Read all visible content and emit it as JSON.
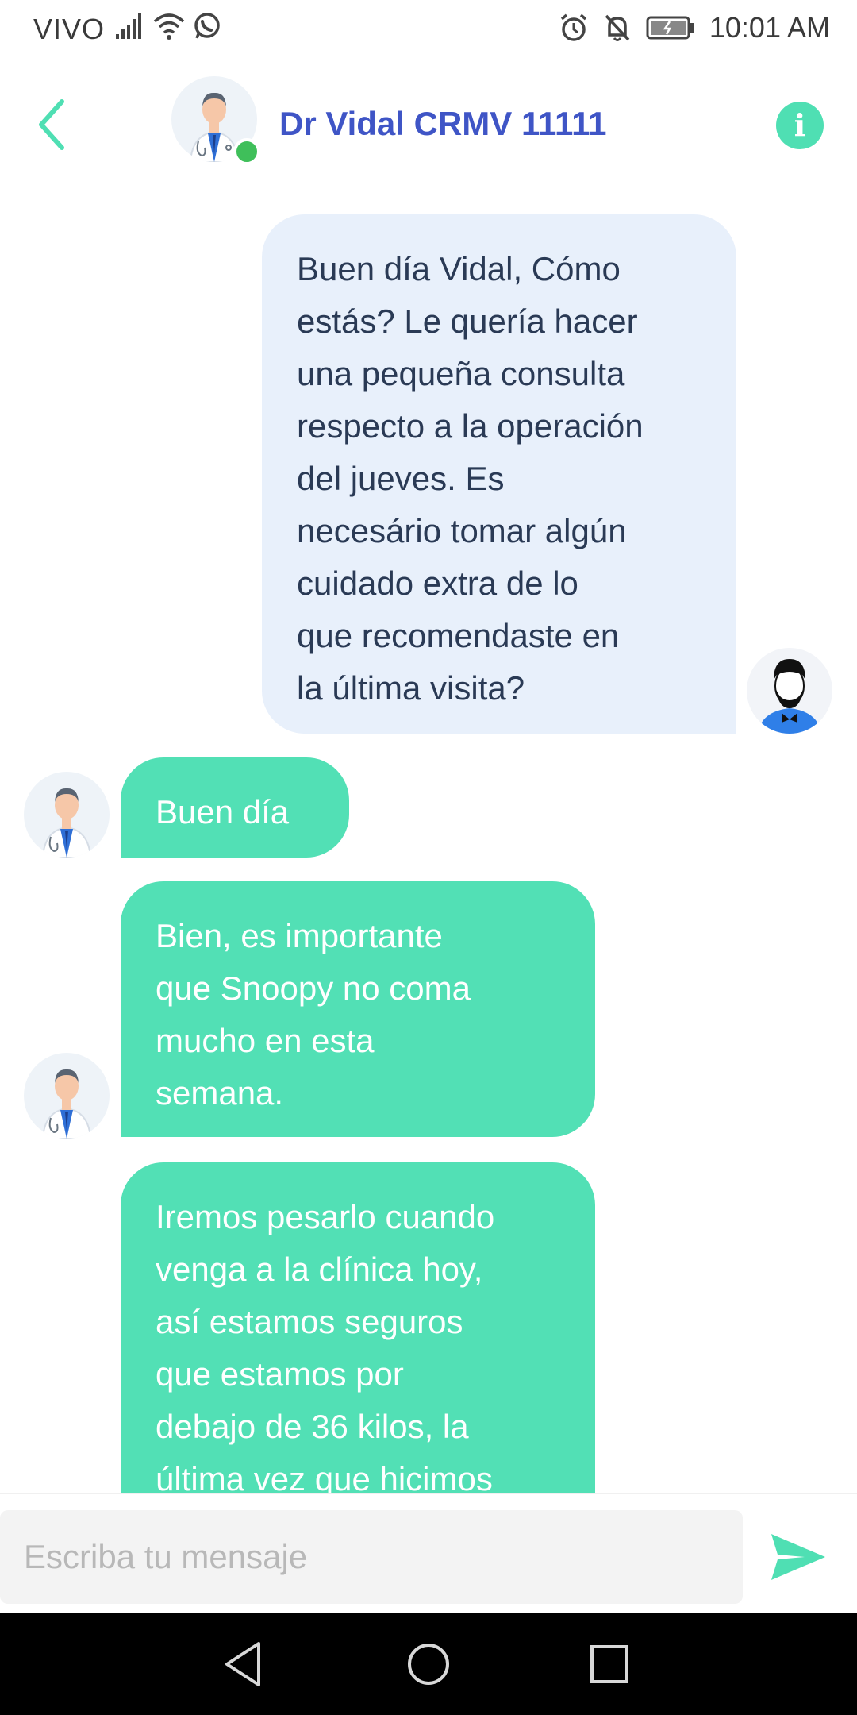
{
  "status_bar": {
    "carrier": "VIVO",
    "time": "10:01 AM"
  },
  "header": {
    "title": "Dr Vidal CRMV 11111",
    "info_label": "i"
  },
  "messages": [
    {
      "direction": "outgoing",
      "lines": [
        "Buen día Vidal, Cómo",
        "estás? Le quería hacer",
        "una pequeña consulta",
        "respecto a la operación",
        "del jueves. Es",
        "necesário tomar algún",
        "cuidado extra de lo",
        "que recomendaste en",
        "la última visita?"
      ]
    },
    {
      "direction": "incoming",
      "lines": [
        "Buen día"
      ]
    },
    {
      "direction": "incoming",
      "lines": [
        "Bien, es importante",
        "que Snoopy no coma",
        "mucho en esta",
        "semana."
      ]
    },
    {
      "direction": "incoming",
      "lines": [
        "Iremos pesarlo cuando",
        "venga a la clínica hoy,",
        "así estamos seguros",
        "que estamos por",
        "debajo de 36 kilos, la",
        "última vez que hicimos"
      ]
    }
  ],
  "composer": {
    "placeholder": "Escriba tu mensaje"
  },
  "colors": {
    "accent": "#52e0b5",
    "title": "#3f55c6",
    "outgoing_bubble": "#e8f0fb",
    "online": "#3fbf5a"
  },
  "icons": {
    "back": "chevron-left-icon",
    "info": "info-icon",
    "send": "send-icon"
  }
}
